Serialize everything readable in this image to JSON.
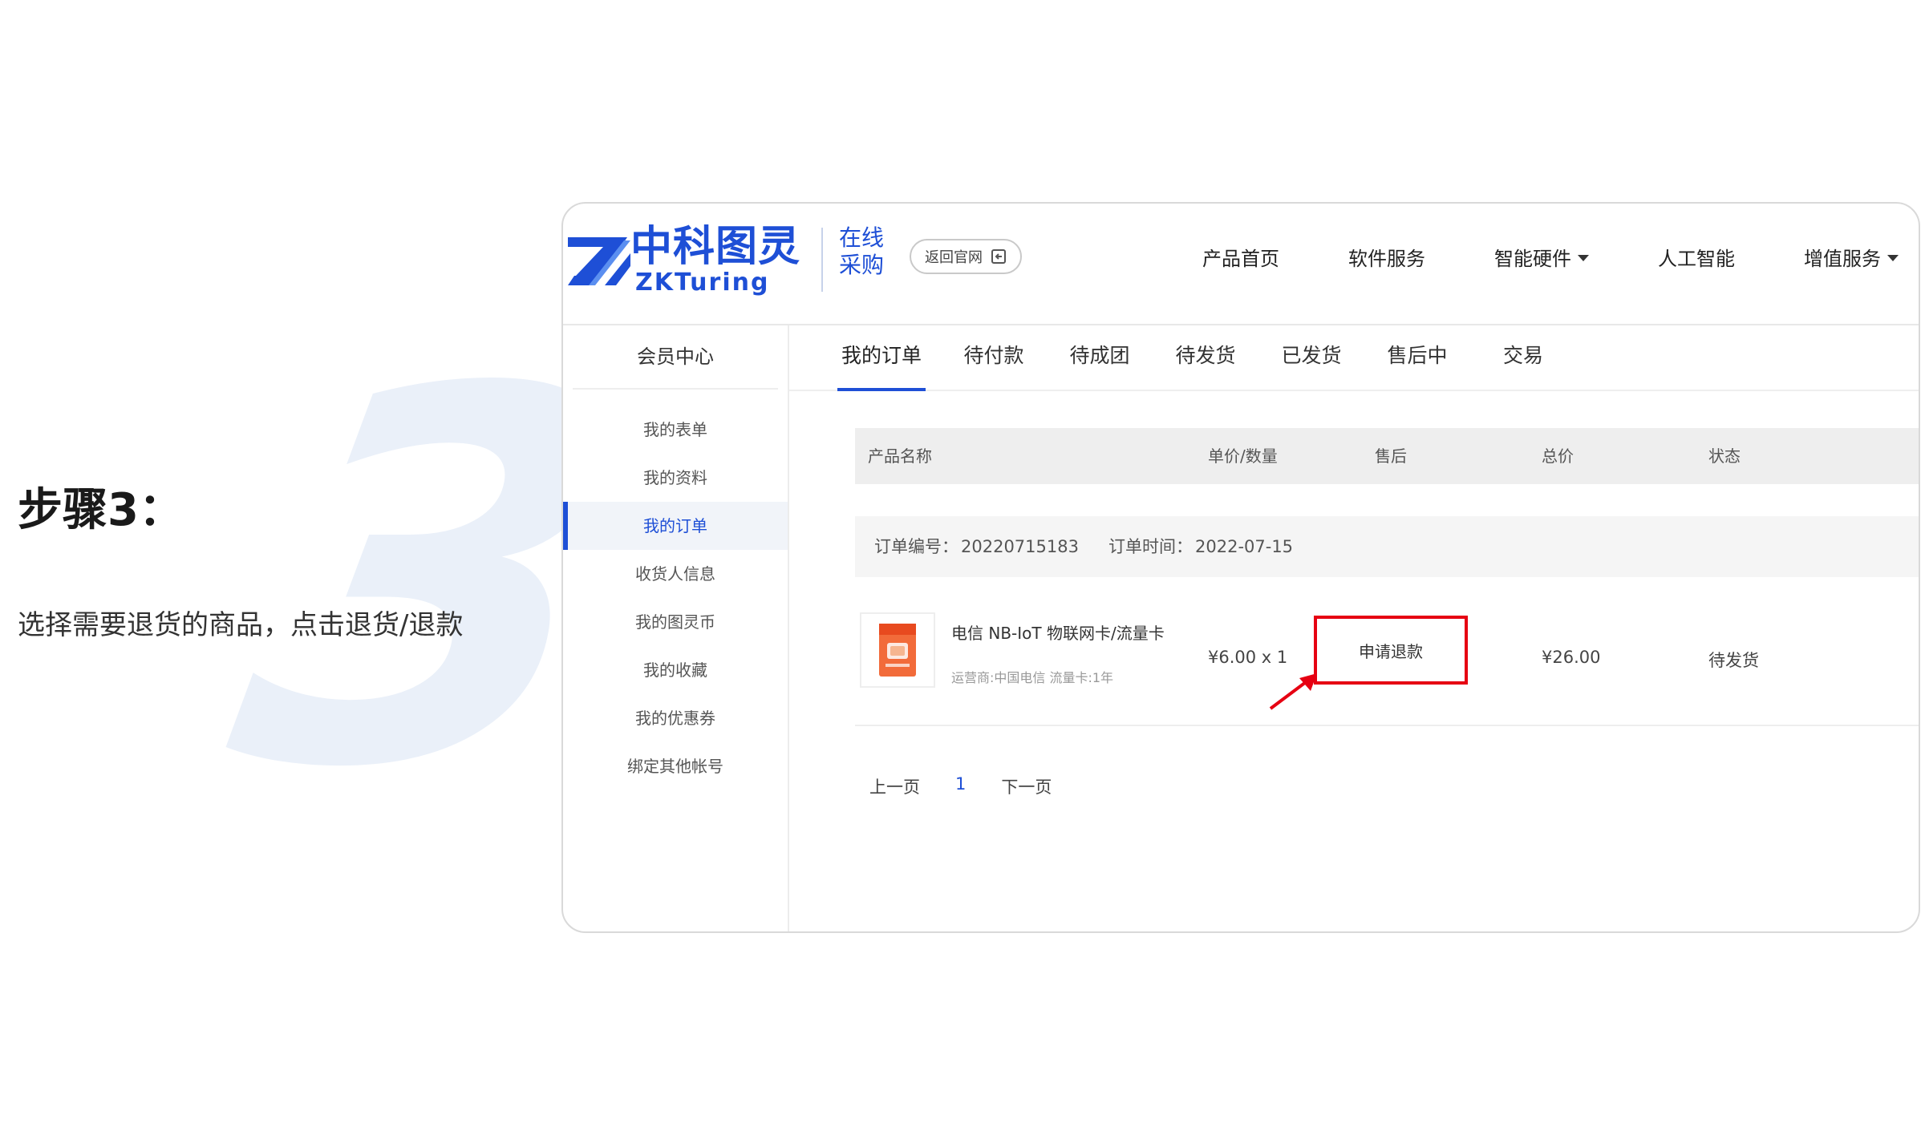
{
  "step": {
    "number": "3",
    "title": "步骤3：",
    "description": "选择需要退货的商品，点击退货/退款"
  },
  "header": {
    "logo_cn": "中科图灵",
    "logo_en": "ZKTuring",
    "logo_sub_line1": "在线",
    "logo_sub_line2": "采购",
    "back_label": "返回官网",
    "nav": [
      {
        "label": "产品首页",
        "dropdown": false
      },
      {
        "label": "软件服务",
        "dropdown": false
      },
      {
        "label": "智能硬件",
        "dropdown": true
      },
      {
        "label": "人工智能",
        "dropdown": false
      },
      {
        "label": "增值服务",
        "dropdown": true
      }
    ]
  },
  "sidebar": {
    "title": "会员中心",
    "items": [
      {
        "label": "我的表单",
        "active": false
      },
      {
        "label": "我的资料",
        "active": false
      },
      {
        "label": "我的订单",
        "active": true
      },
      {
        "label": "收货人信息",
        "active": false
      },
      {
        "label": "我的图灵币",
        "active": false
      },
      {
        "label": "我的收藏",
        "active": false
      },
      {
        "label": "我的优惠券",
        "active": false
      },
      {
        "label": "绑定其他帐号",
        "active": false
      }
    ]
  },
  "tabs": [
    {
      "label": "我的订单",
      "active": true
    },
    {
      "label": "待付款",
      "active": false
    },
    {
      "label": "待成团",
      "active": false
    },
    {
      "label": "待发货",
      "active": false
    },
    {
      "label": "已发货",
      "active": false
    },
    {
      "label": "售后中",
      "active": false
    },
    {
      "label": "交易",
      "active": false
    }
  ],
  "table": {
    "headers": {
      "product": "产品名称",
      "price_qty": "单价/数量",
      "after_sale": "售后",
      "total": "总价",
      "status": "状态"
    }
  },
  "order": {
    "number_label": "订单编号：",
    "number": "20220715183",
    "time_label": "订单时间：",
    "time": "2022-07-15",
    "product_name": "电信 NB-IoT 物联网卡/流量卡",
    "product_meta": "运营商:中国电信 流量卡:1年",
    "price_qty": "¥6.00 x 1",
    "refund_label": "申请退款",
    "total": "¥26.00",
    "status": "待发货"
  },
  "pager": {
    "prev": "上一页",
    "current": "1",
    "next": "下一页"
  },
  "colors": {
    "brand": "#1e4fd6",
    "highlight": "#e60012",
    "watermark": "#eaf0f9"
  }
}
